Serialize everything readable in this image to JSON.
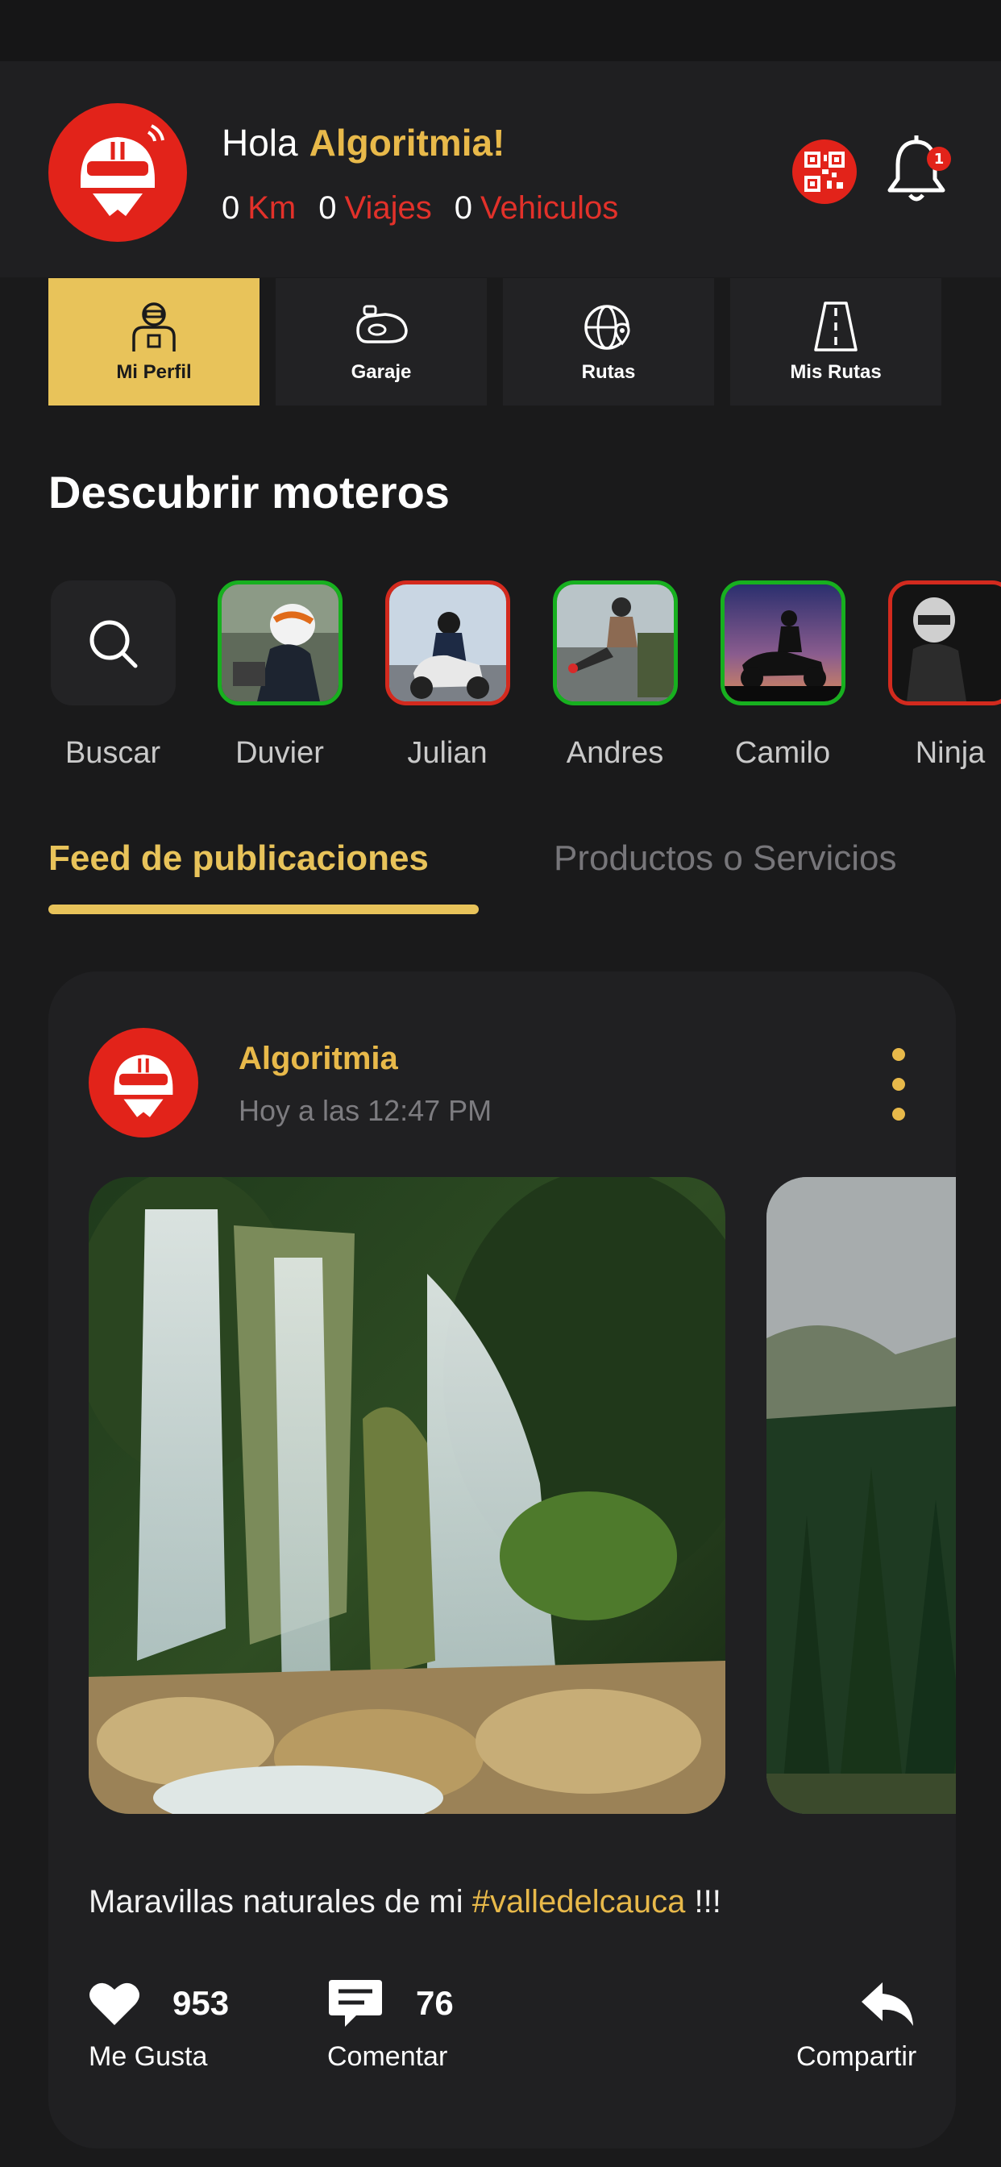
{
  "header": {
    "greeting": "Hola",
    "user_name": "Algoritmia!",
    "stats": [
      {
        "value": "0",
        "label": "Km"
      },
      {
        "value": "0",
        "label": "Viajes"
      },
      {
        "value": "0",
        "label": "Vehiculos"
      }
    ],
    "notification_count": "1"
  },
  "nav_tabs": [
    {
      "label": "Mi Perfil",
      "icon": "rider-profile-icon",
      "active": true
    },
    {
      "label": "Garaje",
      "icon": "motorcycle-tank-icon",
      "active": false
    },
    {
      "label": "Rutas",
      "icon": "globe-pin-icon",
      "active": false
    },
    {
      "label": "Mis Rutas",
      "icon": "road-icon",
      "active": false
    }
  ],
  "discover": {
    "title": "Descubrir moteros",
    "search_label": "Buscar",
    "riders": [
      {
        "name": "Duvier",
        "ring": "#17b01f"
      },
      {
        "name": "Julian",
        "ring": "#d32a1e"
      },
      {
        "name": "Andres",
        "ring": "#17b01f"
      },
      {
        "name": "Camilo",
        "ring": "#17b01f"
      },
      {
        "name": "Ninja",
        "ring": "#d32a1e"
      }
    ]
  },
  "feed_tabs": {
    "active": "Feed de publicaciones",
    "inactive": "Productos o Servicios"
  },
  "post": {
    "author": "Algoritmia",
    "time": "Hoy a las 12:47 PM",
    "caption_text": "Maravillas naturales de mi ",
    "caption_tag": "#valledelcauca",
    "caption_end": " !!!",
    "likes": "953",
    "like_label": "Me Gusta",
    "comments": "76",
    "comment_label": "Comentar",
    "share_label": "Compartir"
  },
  "colors": {
    "accent": "#e8c35a",
    "brand_red": "#e2231a",
    "background": "#1a1a1b"
  }
}
